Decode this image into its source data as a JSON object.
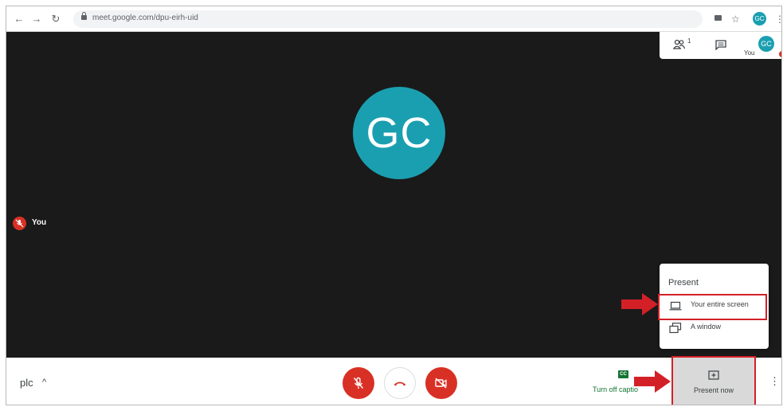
{
  "browser": {
    "url": "meet.google.com/dpu-eirh-uid",
    "profile_initials": "GC"
  },
  "stage": {
    "main_avatar_initials": "GC",
    "self_tile_label": "You"
  },
  "top_panel": {
    "people_count": "1",
    "self_label": "You",
    "self_initials": "GC"
  },
  "present_menu": {
    "title": "Present",
    "items": [
      {
        "label": "Your entire screen",
        "icon": "laptop-icon"
      },
      {
        "label": "A window",
        "icon": "window-icon"
      }
    ]
  },
  "bottom_bar": {
    "meeting_code": "plc",
    "captions_badge": "CC",
    "captions_label": "Turn off captio",
    "present_label": "Present now"
  },
  "colors": {
    "stage_bg": "#1a1a1a",
    "avatar_teal": "#1a9fb0",
    "danger_red": "#d93025",
    "annotation_red": "#d32027",
    "captions_green": "#137333"
  }
}
